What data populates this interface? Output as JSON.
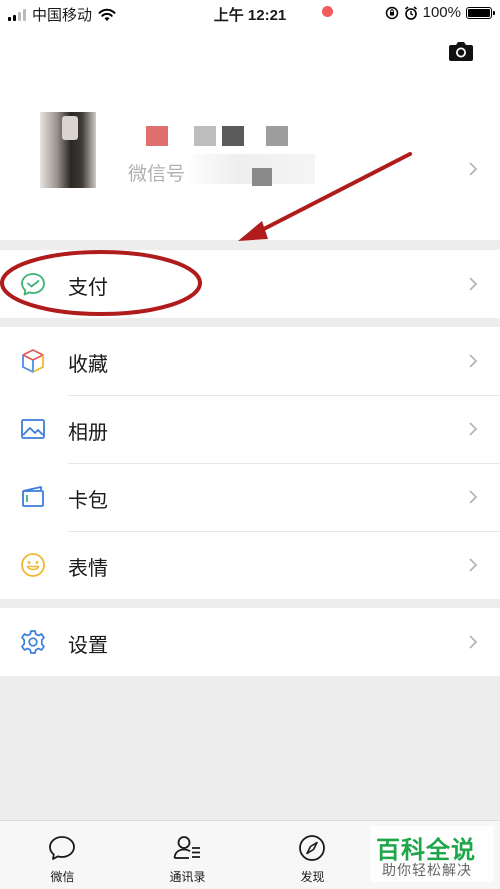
{
  "status_bar": {
    "carrier": "中国移动",
    "time": "上午 12:21",
    "battery": "100%"
  },
  "profile": {
    "wechat_id_label": "微信号"
  },
  "menu": {
    "pay": "支付",
    "favorites": "收藏",
    "album": "相册",
    "cards": "卡包",
    "stickers": "表情",
    "settings": "设置"
  },
  "tabbar": {
    "chats": "微信",
    "contacts": "通讯录",
    "discover": "发现"
  },
  "watermark": {
    "title": "百科全说",
    "subtitle": "助你轻松解决"
  },
  "colors": {
    "annotation_red": "#b01c1c",
    "pay_green": "#3cb371",
    "badge_red": "#f15b5b",
    "watermark_green": "#1fa64a",
    "settings_blue": "#3b7ddd"
  },
  "icons": {
    "camera": "camera-icon",
    "pay": "wallet-check-icon",
    "favorites": "cube-icon",
    "album": "image-icon",
    "cards": "card-icon",
    "stickers": "smiley-icon",
    "settings": "gear-icon"
  }
}
